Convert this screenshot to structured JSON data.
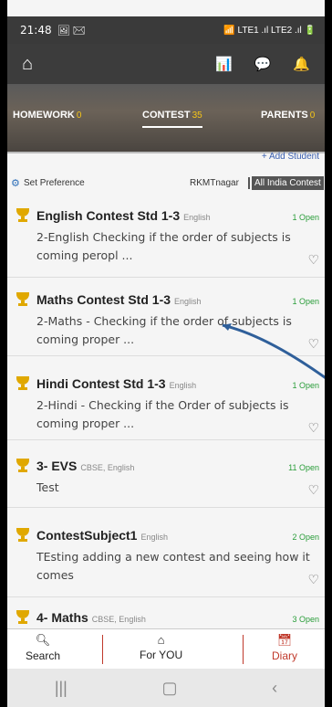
{
  "status": {
    "time": "21:48",
    "left_icons": "🖼 ✉",
    "right_icons": "📶 LTE1 .ıl LTE2 .ıl 🔋"
  },
  "toolbar": {
    "home_icon": "home-icon",
    "tools": [
      "chart-icon",
      "chat-icon",
      "bell-icon"
    ]
  },
  "tabs": [
    {
      "label": "HOMEWORK",
      "count": "0"
    },
    {
      "label": "CONTEST",
      "count": "35"
    },
    {
      "label": "PARENTS",
      "count": "0"
    }
  ],
  "add_student": "+ Add Student",
  "preference": {
    "label": "Set Preference",
    "location": "RKMTnagar",
    "scope": "All India Contest"
  },
  "contests": [
    {
      "title": "English Contest Std 1-3",
      "tag": "English",
      "open": "1 Open",
      "desc": "2-English Checking if the order of subjects is coming peropl ..."
    },
    {
      "title": "Maths Contest Std 1-3",
      "tag": "English",
      "open": "1 Open",
      "desc": "2-Maths - Checking if the order of subjects is coming proper ..."
    },
    {
      "title": "Hindi Contest Std 1-3",
      "tag": "English",
      "open": "1 Open",
      "desc": "2-Hindi - Checking if the Order of subjects is coming proper ..."
    },
    {
      "title": "3- EVS",
      "tag": "CBSE, English",
      "open": "11 Open",
      "desc": "Test"
    },
    {
      "title": "ContestSubject1",
      "tag": "English",
      "open": "2 Open",
      "desc": "TEsting adding a new contest and seeing how it comes"
    },
    {
      "title": "4- Maths",
      "tag": "CBSE, English",
      "open": "3 Open",
      "desc": ""
    }
  ],
  "nav": [
    {
      "label": "Search",
      "icon": "search-icon"
    },
    {
      "label": "For YOU",
      "icon": "home-icon"
    },
    {
      "label": "Diary",
      "icon": "calendar-icon"
    }
  ],
  "colors": {
    "accent": "#c0392b",
    "open_green": "#2a9d3a",
    "trophy": "#e0a800"
  }
}
